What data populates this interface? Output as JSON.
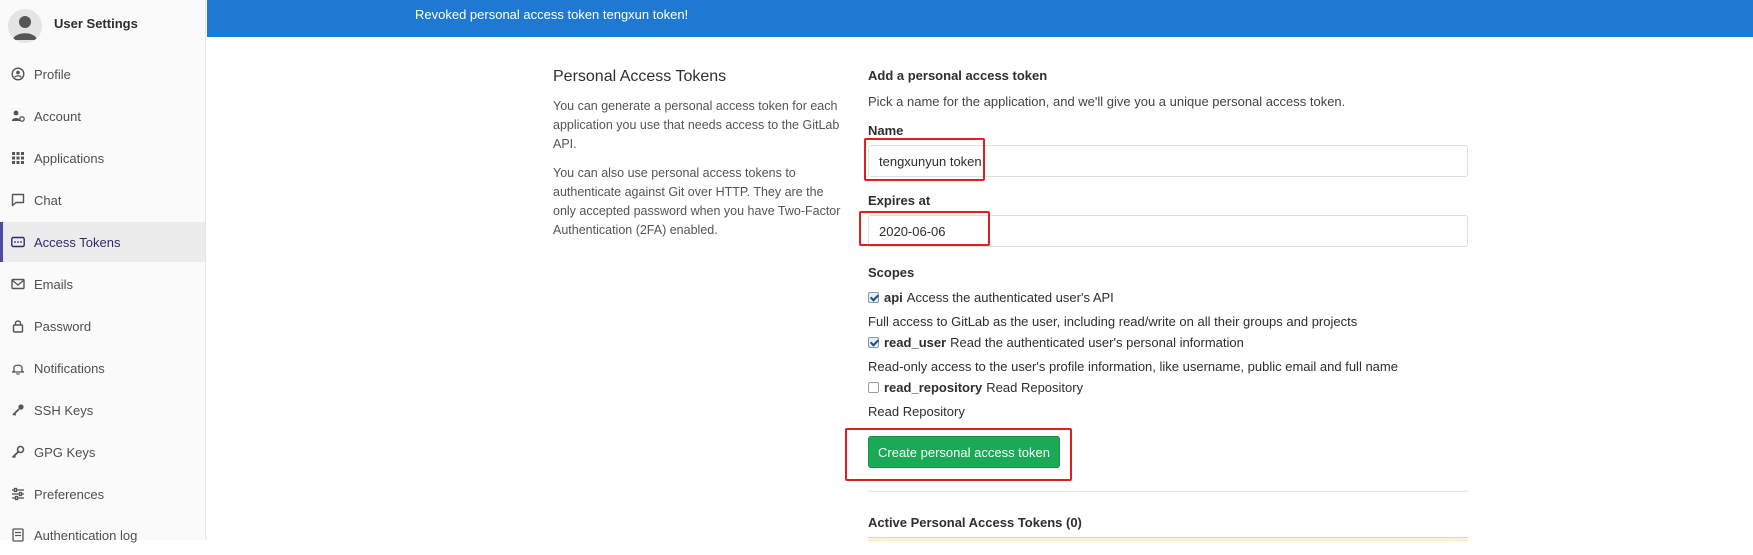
{
  "sidebar": {
    "title": "User Settings",
    "items": [
      {
        "label": "Profile",
        "icon": "profile-icon"
      },
      {
        "label": "Account",
        "icon": "account-icon"
      },
      {
        "label": "Applications",
        "icon": "applications-icon"
      },
      {
        "label": "Chat",
        "icon": "chat-icon"
      },
      {
        "label": "Access Tokens",
        "icon": "access-tokens-icon",
        "active": true
      },
      {
        "label": "Emails",
        "icon": "emails-icon"
      },
      {
        "label": "Password",
        "icon": "password-icon"
      },
      {
        "label": "Notifications",
        "icon": "notifications-icon"
      },
      {
        "label": "SSH Keys",
        "icon": "ssh-keys-icon"
      },
      {
        "label": "GPG Keys",
        "icon": "gpg-keys-icon"
      },
      {
        "label": "Preferences",
        "icon": "preferences-icon"
      },
      {
        "label": "Authentication log",
        "icon": "authentication-log-icon"
      }
    ]
  },
  "banner": {
    "text": "Revoked personal access token tengxun token!"
  },
  "description": {
    "title": "Personal Access Tokens",
    "p1": "You can generate a personal access token for each application you use that needs access to the GitLab API.",
    "p2": "You can also use personal access tokens to authenticate against Git over HTTP. They are the only accepted password when you have Two-Factor Authentication (2FA) enabled."
  },
  "form": {
    "heading": "Add a personal access token",
    "subheading": "Pick a name for the application, and we'll give you a unique personal access token.",
    "name_label": "Name",
    "name_value": "tengxunyun token",
    "expires_label": "Expires at",
    "expires_value": "2020-06-06",
    "scopes_label": "Scopes",
    "scopes": [
      {
        "name": "api",
        "description": "Access the authenticated user's API",
        "help": "Full access to GitLab as the user, including read/write on all their groups and projects",
        "checked": true
      },
      {
        "name": "read_user",
        "description": "Read the authenticated user's personal information",
        "help": "Read-only access to the user's profile information, like username, public email and full name",
        "checked": true
      },
      {
        "name": "read_repository",
        "description": "Read Repository",
        "help": "Read Repository",
        "checked": false
      }
    ],
    "submit_label": "Create personal access token"
  },
  "active_tokens": {
    "heading": "Active Personal Access Tokens (0)"
  },
  "colors": {
    "banner": "#1f78d1",
    "submit": "#1aaa55",
    "highlight_box": "#e02020",
    "active_nav_border": "#4b4ba3"
  }
}
